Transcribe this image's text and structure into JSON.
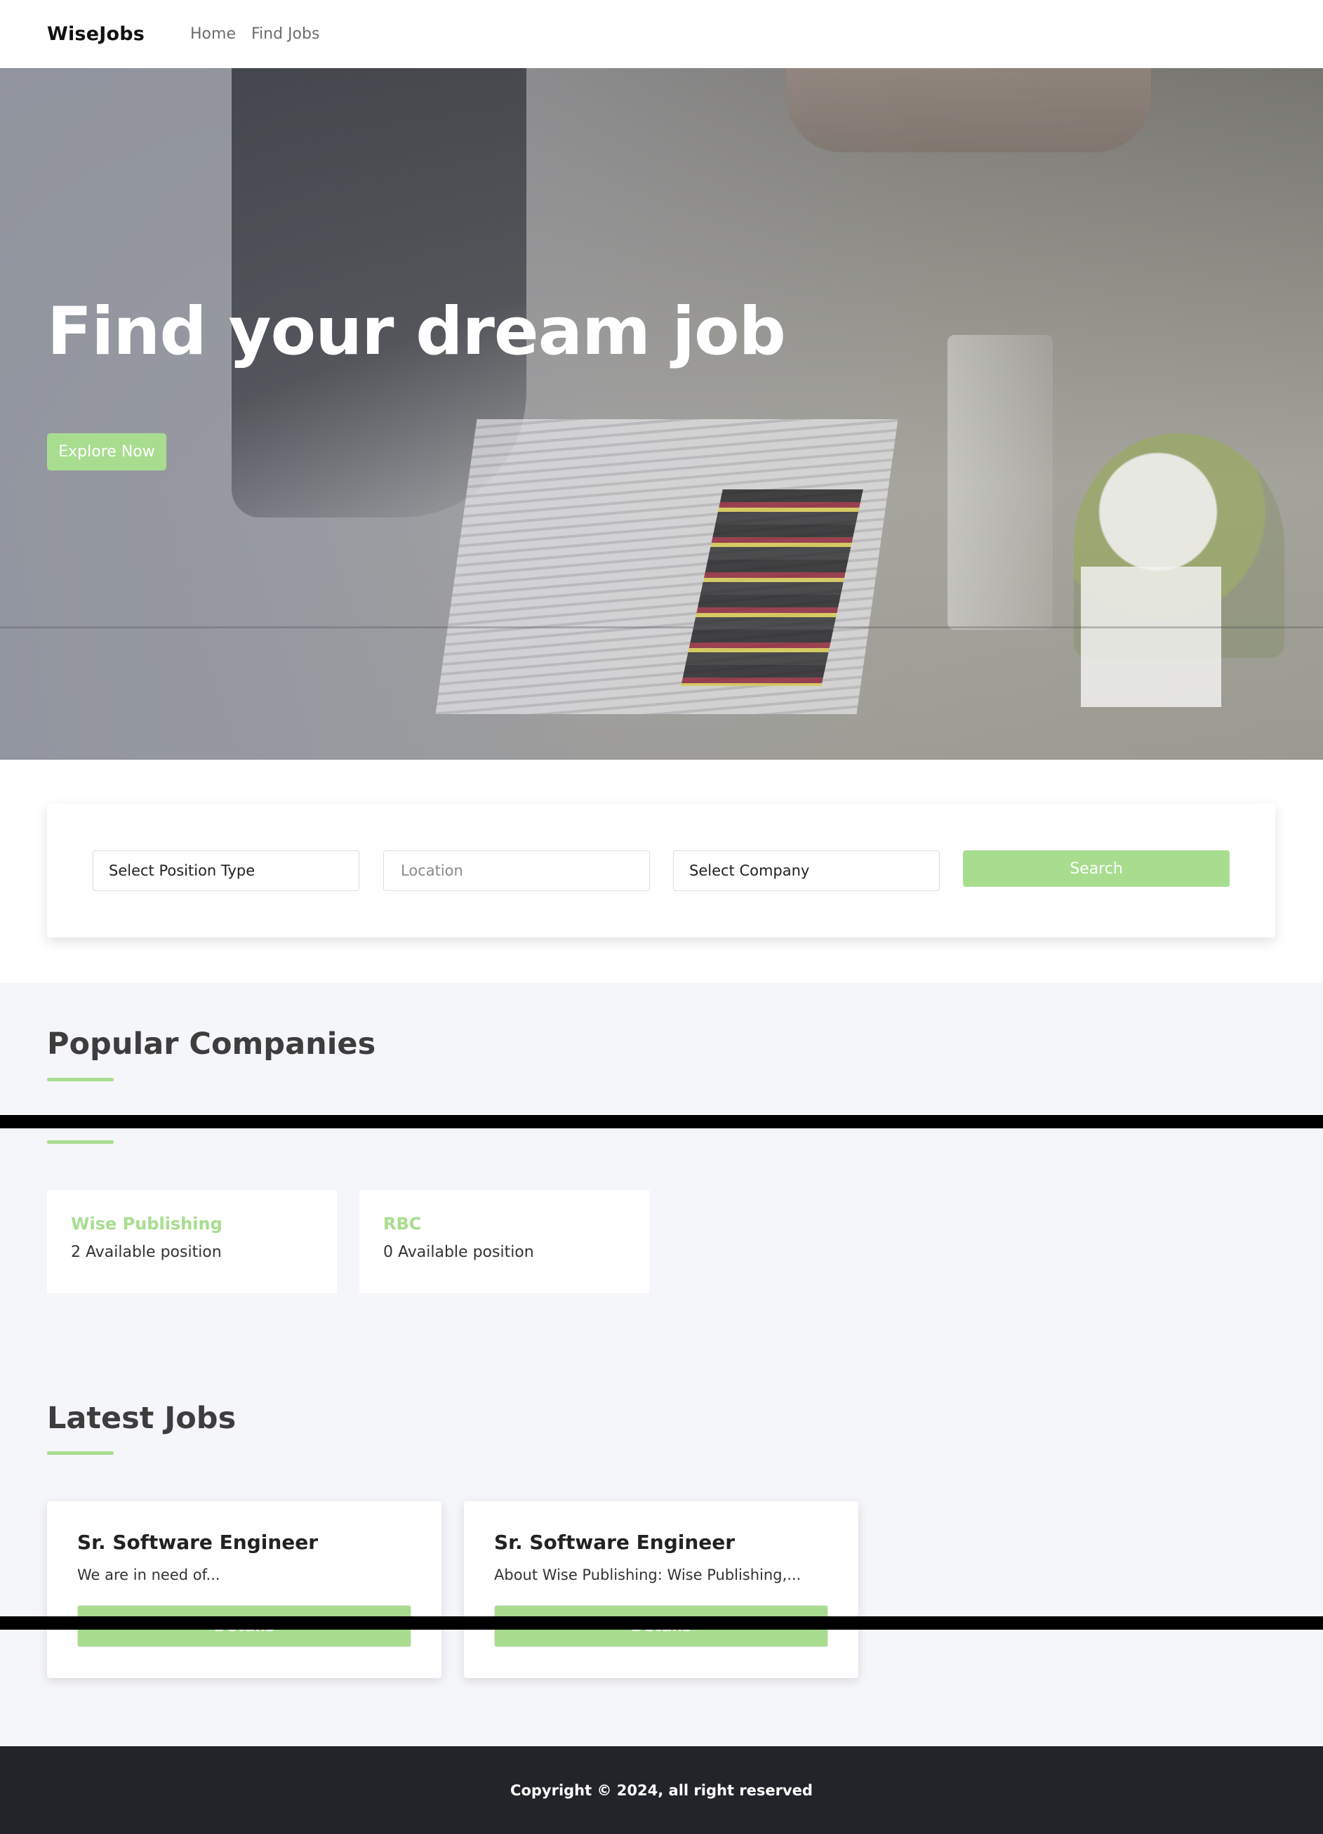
{
  "nav": {
    "brand": "WiseJobs",
    "links": [
      "Home",
      "Find Jobs"
    ]
  },
  "hero": {
    "title": "Find your dream job",
    "cta_label": "Explore Now"
  },
  "search": {
    "position_type": "Select Position Type",
    "location_placeholder": "Location",
    "company": "Select Company",
    "button_label": "Search"
  },
  "popular_companies": {
    "title": "Popular Companies",
    "companies": [
      {
        "name": "Wise Publishing",
        "positions": "2 Available position"
      },
      {
        "name": "RBC",
        "positions": "0 Available position"
      }
    ]
  },
  "latest_jobs": {
    "title": "Latest Jobs",
    "jobs": [
      {
        "title": "Sr. Software Engineer",
        "description": "We are in need of...",
        "button_label": "Details"
      },
      {
        "title": "Sr. Software Engineer",
        "description": "About Wise Publishing: Wise Publishing,...",
        "button_label": "Details"
      }
    ]
  },
  "footer": {
    "copyright": "Copyright © 2024, all right reserved"
  },
  "colors": {
    "accent": "#a8dd8f",
    "footer_bg": "#222429",
    "section_bg": "#f5f6f9"
  }
}
